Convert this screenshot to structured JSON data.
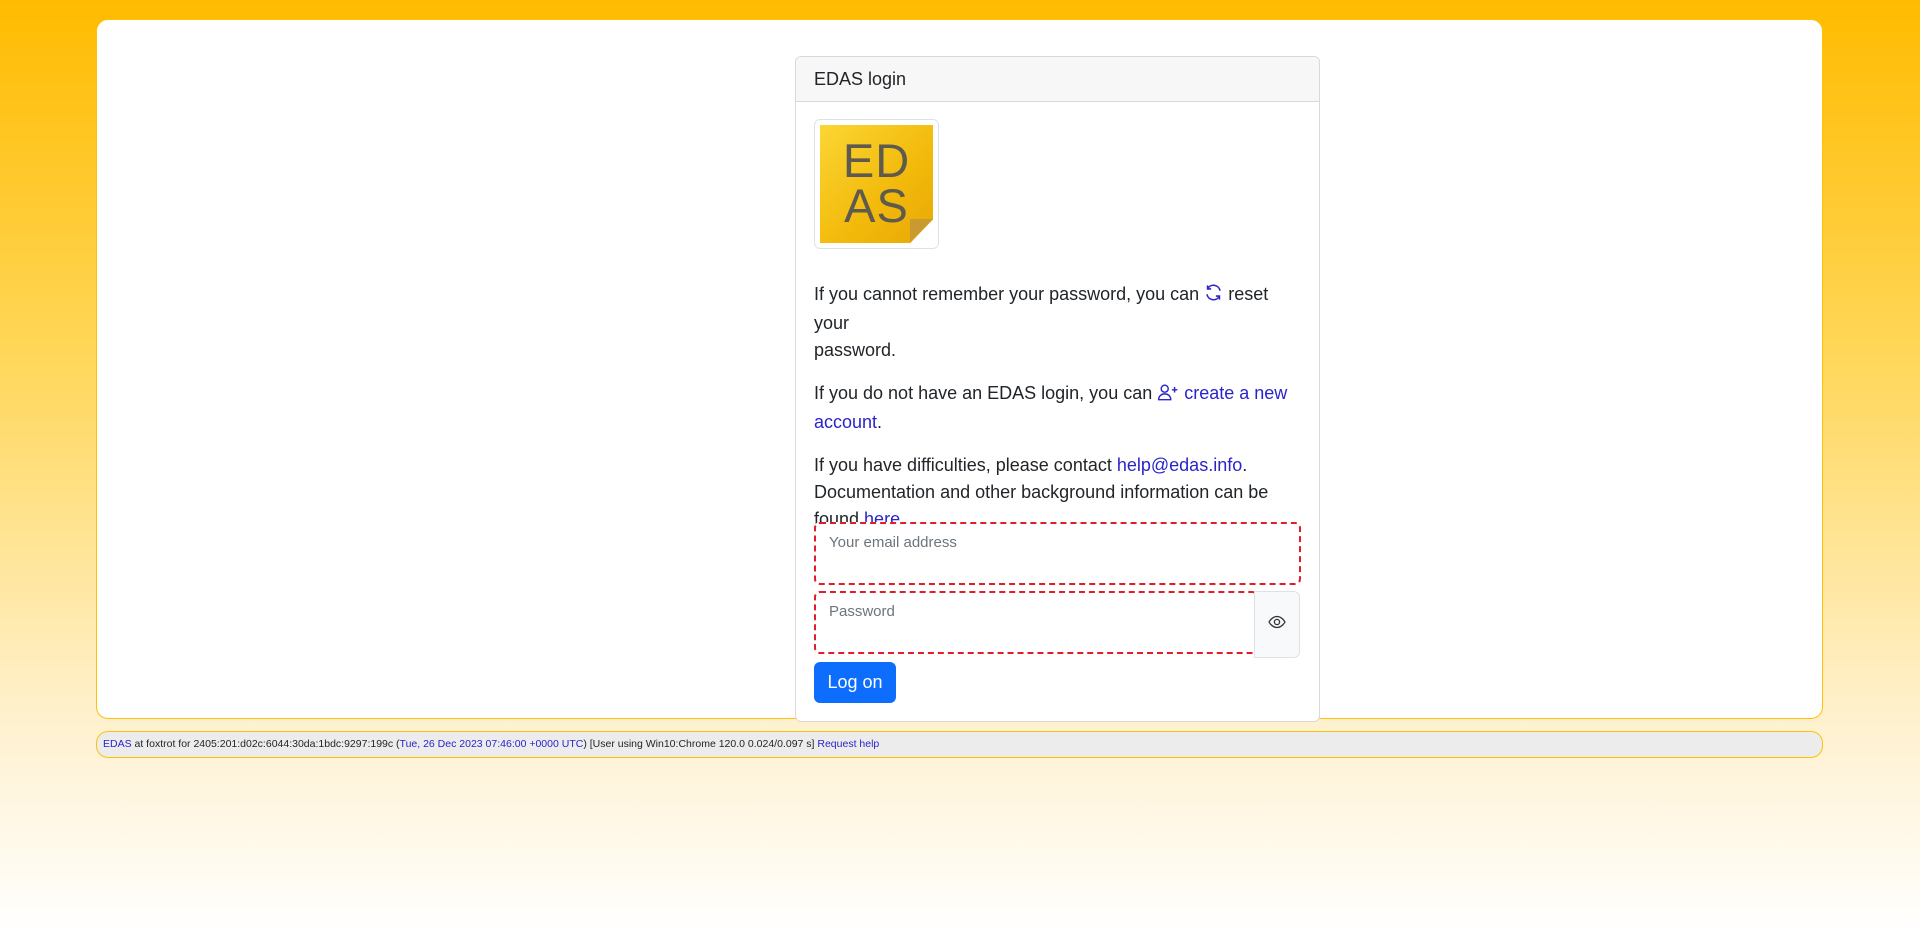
{
  "card": {
    "title": "EDAS login",
    "logo_line1": "ED",
    "logo_line2": "AS"
  },
  "reset": {
    "text_before": "If you cannot remember your password, you can ",
    "link": "reset your",
    "text_after": "password."
  },
  "create": {
    "text_before": "If you do not have an EDAS login, you can ",
    "link_part1": "create a new",
    "link_part2": "account",
    "text_after": "."
  },
  "help": {
    "text_before": "If you have difficulties, please contact ",
    "email_link": "help@edas.info",
    "text_middle": ".",
    "line2": "Documentation and other background information can be",
    "line3_before": "found ",
    "here_link": "here",
    "line3_after": "."
  },
  "form": {
    "email_label": "Your email address",
    "email_value": "",
    "password_label": "Password",
    "password_value": "",
    "logon_label": "Log on"
  },
  "footer": {
    "edas_link": "EDAS",
    "host_text": " at foxtrot for 2405:201:d02c:6044:30da:1bdc:9297:199c (",
    "timestamp": "Tue, 26 Dec 2023 07:46:00 +0000 UTC",
    "user_text": ") [User using Win10:Chrome 120.0 0.024/0.097 s] ",
    "help_link": "Request help"
  },
  "icons": {
    "reset": "refresh-icon",
    "create": "person-plus-icon",
    "toggle": "eye-icon"
  },
  "colors": {
    "accent": "#ffbb00",
    "link": "#2a24c9",
    "primary_button": "#0d6efd",
    "invalid_border": "#e11d2a"
  }
}
